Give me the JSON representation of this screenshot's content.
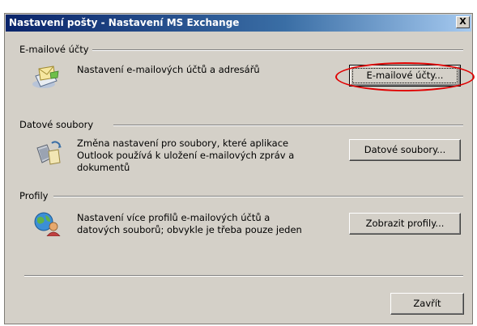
{
  "window": {
    "title": "Nastavení pošty - Nastavení MS Exchange",
    "close_label": "X"
  },
  "sections": {
    "email": {
      "heading": "E-mailové účty",
      "description": "Nastavení e-mailových účtů a adresářů",
      "button_label": "E-mailové účty...",
      "icon": "mail-envelope-icon"
    },
    "data": {
      "heading": "Datové soubory",
      "description_line1": "Změna nastavení pro soubory, které aplikace",
      "description_line2": "Outlook používá k uložení e-mailových zpráv a",
      "description_line3": "dokumentů",
      "button_label": "Datové soubory...",
      "icon": "data-files-icon"
    },
    "profiles": {
      "heading": "Profily",
      "description_line1": "Nastavení více profilů e-mailových účtů a",
      "description_line2": "datových souborů; obvykle je třeba pouze jeden",
      "button_label": "Zobrazit profily...",
      "icon": "profiles-globe-icon"
    }
  },
  "footer": {
    "close_button_label": "Zavřít"
  },
  "colors": {
    "titlebar_start": "#0a246a",
    "titlebar_end": "#a6caf0",
    "dialog_bg": "#d4d0c8",
    "highlight_ellipse": "#e00000"
  }
}
